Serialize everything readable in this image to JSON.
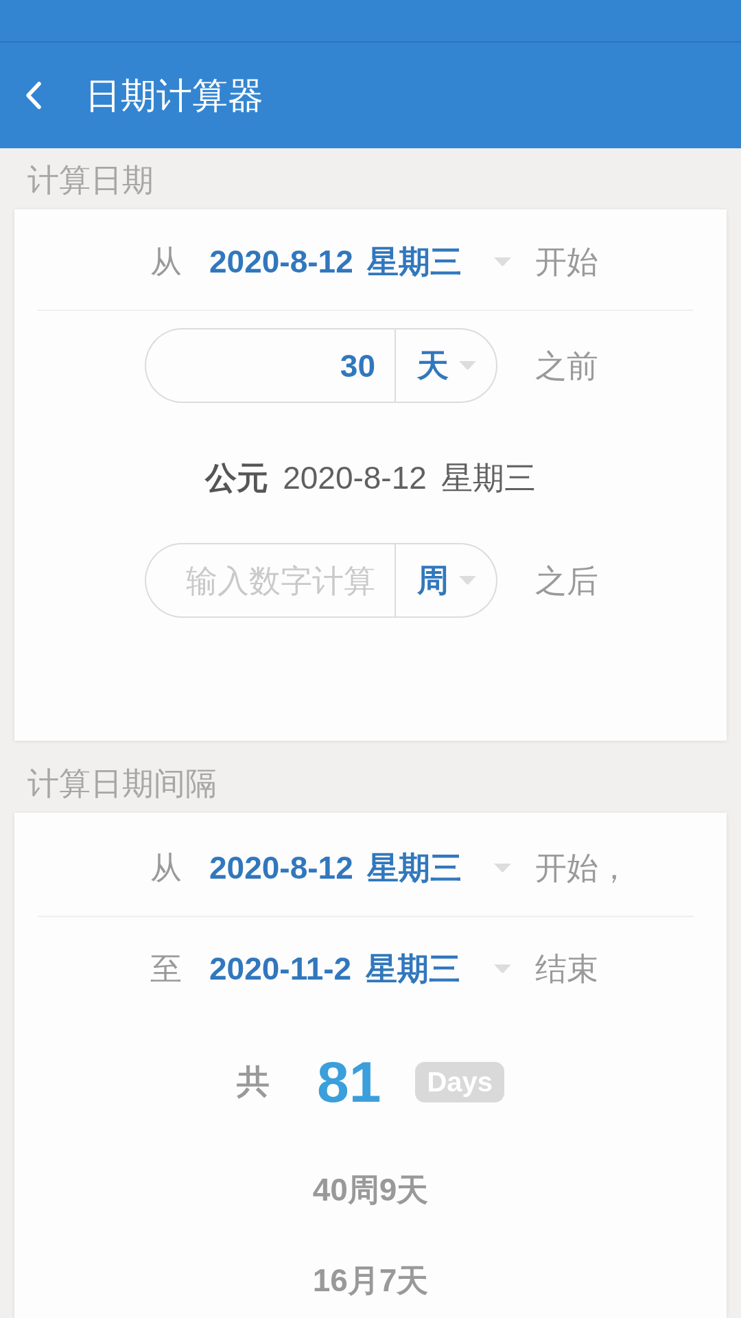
{
  "app_bar": {
    "title": "日期计算器"
  },
  "sections": [
    {
      "header": "计算日期",
      "rows": [
        {
          "kind": "date",
          "prefix": "从",
          "date": "2020-8-12 星期三",
          "suffix": "开始"
        },
        {
          "kind": "offset",
          "value": "30",
          "unit": "天",
          "suffix": "之前"
        },
        {
          "kind": "result",
          "text": "**公元** 2020-8-12 星期三"
        },
        {
          "kind": "offset",
          "placeholder": "输入数字计算",
          "unit": "周",
          "suffix": "之后"
        }
      ]
    },
    {
      "header": "计算日期间隔",
      "rows": [
        {
          "kind": "date",
          "prefix": "从",
          "date": "2020-8-12 星期三",
          "suffix": "开始，"
        },
        {
          "kind": "date",
          "prefix": "至",
          "date": "2020-11-2 星期三",
          "suffix": "结束"
        },
        {
          "kind": "total",
          "prefix": "共",
          "value": "81",
          "unit": "Days"
        },
        {
          "kind": "note",
          "text": "40周9天"
        },
        {
          "kind": "note",
          "text": "16月7天"
        }
      ]
    }
  ]
}
